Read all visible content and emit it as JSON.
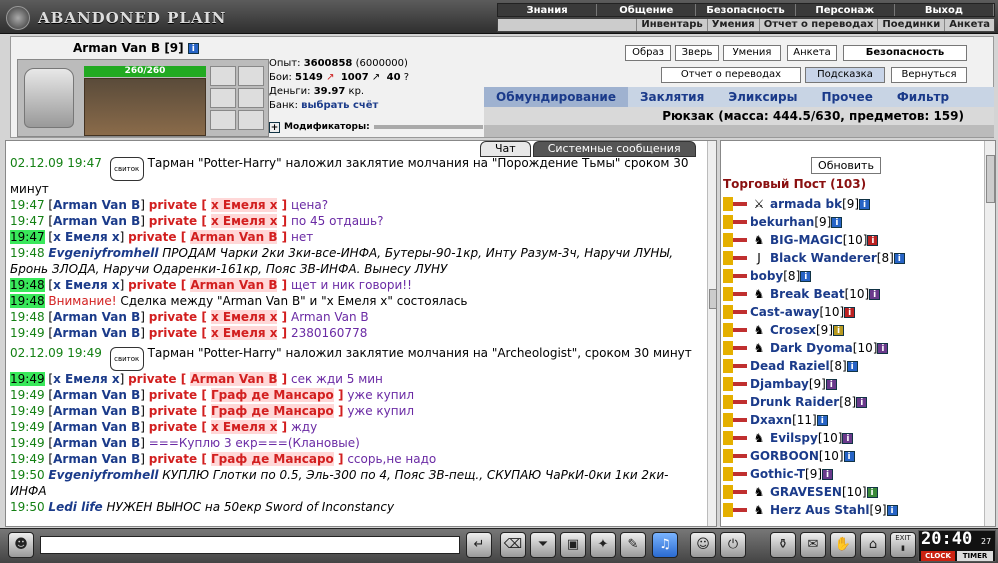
{
  "app": {
    "title": "ABANDONED PLAIN"
  },
  "menu_top": [
    "Знания",
    "Общение",
    "Безопасность",
    "Персонаж",
    "Выход"
  ],
  "menu_sub": [
    "Инвентарь",
    "Умения",
    "Отчет о переводах",
    "Поединки",
    "Анкета"
  ],
  "character": {
    "name": "Arman Van B",
    "level": "[9]",
    "hp": "260/260",
    "exp_label": "Опыт:",
    "exp_value": "3600858",
    "exp_next": "(6000000)",
    "fights_label": "Бои:",
    "wins": "5149",
    "losses": "1007",
    "draws": "40",
    "money_label": "Деньги:",
    "money_value": "39.97",
    "money_unit": "кр.",
    "bank_label": "Банк:",
    "bank_link": "выбрать счёт",
    "mods_label": "Модификаторы:"
  },
  "buttons_row1": [
    "Образ",
    "Зверь",
    "Умения",
    "Анкета",
    "Безопасность"
  ],
  "buttons_row2": [
    "Отчет о переводах",
    "Подсказка",
    "Вернуться"
  ],
  "inv_tabs": [
    "Обмундирование",
    "Заклятия",
    "Эликсиры",
    "Прочее",
    "Фильтр"
  ],
  "pack": {
    "text": "Рюкзак (масса: 444.5/630, предметов: 159)"
  },
  "chat_tabs": [
    "Чат",
    "Системные сообщения"
  ],
  "chat": [
    {
      "time": "02.12.09 19:47",
      "sys": "Тарман \"Potter-Harry\" наложил заклятие молчания на \"Порождение Тьмы\" сроком 30 минут"
    },
    {
      "time": "19:47",
      "nick": "Arman Van B",
      "to": "х Емеля х",
      "text": "цена?"
    },
    {
      "time": "19:47",
      "nick": "Arman Van B",
      "to": "х Емеля х",
      "text": "по 45 отдашь?"
    },
    {
      "time": "19:47",
      "hl": true,
      "nick": "х Емеля х",
      "to": "Arman Van B",
      "text": "нет"
    },
    {
      "time": "19:48",
      "em": "Evgeniyfromhell",
      "etext": "ПРОДАМ Чарки 2ки 3ки-все-ИНФА, Бутеры-90-1кр, Инту Разум-3ч, Наручи ЛУНЫ, Бронь ЗЛОДА, Наручи Одаренки-161кр, Пояс ЗВ-ИНФА. Вынесу ЛУНУ"
    },
    {
      "time": "19:48",
      "hl": true,
      "nick": "х Емеля х",
      "to": "Arman Van B",
      "text": "щет и ник говори!!"
    },
    {
      "time": "19:48",
      "hl": true,
      "warn": "Внимание!",
      "plain": "Сделка между \"Arman Van B\" и \"х Емеля х\" состоялась"
    },
    {
      "time": "19:48",
      "nick": "Arman Van B",
      "to": "х Емеля х",
      "text": "Arman Van B"
    },
    {
      "time": "19:49",
      "nick": "Arman Van B",
      "to": "х Емеля х",
      "text": "2380160778"
    },
    {
      "time": "02.12.09 19:49",
      "sys": "Тарман \"Potter-Harry\" наложил заклятие молчания на \"Archeologist\", сроком 30 минут"
    },
    {
      "time": "19:49",
      "hl": true,
      "nick": "х Емеля х",
      "to": "Arman Van B",
      "text": "сек жди 5 мин"
    },
    {
      "time": "19:49",
      "nick": "Arman Van B",
      "to": "Граф де Мансаро",
      "text": "уже купил"
    },
    {
      "time": "19:49",
      "nick": "Arman Van B",
      "to": "Граф де Мансаро",
      "text": "уже купил"
    },
    {
      "time": "19:49",
      "nick": "Arman Van B",
      "to": "х Емеля х",
      "text": "жду"
    },
    {
      "time": "19:49",
      "nick": "Arman Van B",
      "public": "===Куплю 3 екр===(Клановые)"
    },
    {
      "time": "19:49",
      "nick": "Arman Van B",
      "to": "Граф де Мансаро",
      "text": "ссорь,не надо"
    },
    {
      "time": "19:50",
      "em": "Evgeniyfromhell",
      "etext": "КУПЛЮ Глотки по 0.5, Эль-300 по 4, Пояс ЗВ-пещ., СКУПАЮ ЧаРкИ-0ки 1ки 2ки-ИНФА"
    },
    {
      "time": "19:50",
      "em": "Ledi life",
      "etext": "НУЖЕН ВЫНОС на 50екр Sword of Inconstancy"
    }
  ],
  "private_word": "private",
  "sys_icon_label": "свиток",
  "right": {
    "refresh": "Обновить",
    "header": "Торговый Пост (103)",
    "users": [
      {
        "name": "armada bk",
        "lvl": "[9]",
        "icon": "sword-icon",
        "badge": "b"
      },
      {
        "name": "bekurhan",
        "lvl": "[9]",
        "badge": "b"
      },
      {
        "name": "BIG-MAGIC",
        "lvl": "[10]",
        "icon": "clan-icon",
        "badge": "r"
      },
      {
        "name": "Black Wanderer",
        "lvl": "[8]",
        "icon": "j-icon",
        "badge": "b"
      },
      {
        "name": "boby",
        "lvl": "[8]",
        "badge": "b"
      },
      {
        "name": "Break Beat",
        "lvl": "[10]",
        "icon": "clan-icon",
        "badge": "p"
      },
      {
        "name": "Cast-away",
        "lvl": "[10]",
        "badge": "r"
      },
      {
        "name": "Crosex",
        "lvl": "[9]",
        "icon": "clan-icon",
        "badge": "y"
      },
      {
        "name": "Dark Dyoma",
        "lvl": "[10]",
        "icon": "clan-icon",
        "badge": "p"
      },
      {
        "name": "Dead Raziel",
        "lvl": "[8]",
        "badge": "b"
      },
      {
        "name": "Djambay",
        "lvl": "[9]",
        "badge": "p"
      },
      {
        "name": "Drunk Raider",
        "lvl": "[8]",
        "badge": "p"
      },
      {
        "name": "Dxaxn",
        "lvl": "[11]",
        "badge": "b"
      },
      {
        "name": "Evilspy",
        "lvl": "[10]",
        "icon": "clan-icon",
        "badge": "p"
      },
      {
        "name": "GORBOON",
        "lvl": "[10]",
        "badge": "b"
      },
      {
        "name": "Gothic-T",
        "lvl": "[9]",
        "badge": "p"
      },
      {
        "name": "GRAVESEN",
        "lvl": "[10]",
        "icon": "clan-icon",
        "badge": "g"
      },
      {
        "name": "Herz Aus Stahl",
        "lvl": "[9]",
        "icon": "clan-icon",
        "badge": "b"
      }
    ]
  },
  "clock": {
    "time": "20:40",
    "sec": "27",
    "label1": "CLOCK",
    "label2": "TIMER",
    "exit": "EXIT"
  },
  "colors": {
    "accent": "#1b3b8a",
    "private": "#d21f1f",
    "time": "#138013",
    "highlight": "#39e85a"
  }
}
